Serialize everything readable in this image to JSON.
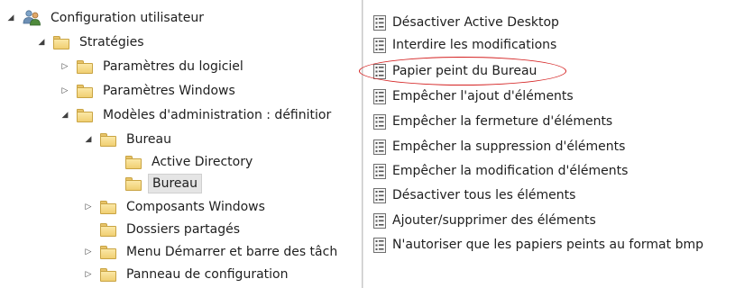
{
  "tree": {
    "root": {
      "label": "Configuration utilisateur",
      "expanded": true
    },
    "strategies": {
      "label": "Stratégies",
      "expanded": true
    },
    "param_logiciel": {
      "label": "Paramètres du logiciel",
      "expanded": false
    },
    "param_windows": {
      "label": "Paramètres Windows",
      "expanded": false
    },
    "modeles_admin": {
      "label": "Modèles d'administration : définitior",
      "expanded": true
    },
    "bureau_parent": {
      "label": "Bureau",
      "expanded": true
    },
    "active_directory": {
      "label": "Active Directory"
    },
    "bureau_child": {
      "label": "Bureau",
      "selected": true
    },
    "composants_windows": {
      "label": "Composants Windows",
      "expanded": false
    },
    "dossiers_partages": {
      "label": "Dossiers partagés"
    },
    "menu_demarrer": {
      "label": "Menu Démarrer et barre des tâch",
      "expanded": false
    },
    "panneau_config": {
      "label": "Panneau de configuration",
      "expanded": false
    }
  },
  "policies": [
    "Désactiver Active Desktop",
    "Interdire les modifications",
    "Papier peint du Bureau",
    "Empêcher l'ajout d'éléments",
    "Empêcher la fermeture d'éléments",
    "Empêcher la suppression d'éléments",
    "Empêcher la modification d'éléments",
    "Désactiver tous les éléments",
    "Ajouter/supprimer des éléments",
    "N'autoriser que les papiers peints au format bmp"
  ],
  "icons": {
    "expanded": "◢",
    "collapsed": "▷"
  },
  "colors": {
    "highlight_ellipse": "#d42020",
    "folder": "#f0cf72",
    "selection": "#e5e5e5"
  }
}
